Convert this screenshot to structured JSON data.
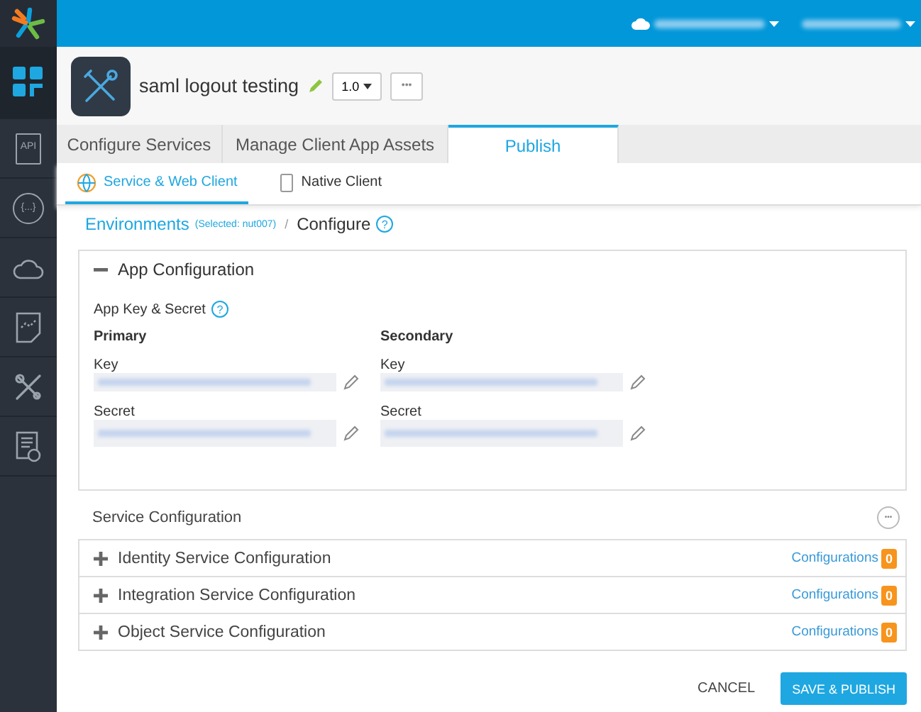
{
  "sidebar": {
    "items": [
      {
        "kind": "dashboard",
        "selected": true
      },
      {
        "kind": "api",
        "label": "API",
        "selected": false
      },
      {
        "kind": "chat",
        "label": "{...}",
        "selected": false
      },
      {
        "kind": "cloud",
        "selected": false
      },
      {
        "kind": "chart",
        "selected": false
      },
      {
        "kind": "tools",
        "selected": false
      },
      {
        "kind": "report",
        "selected": false
      }
    ]
  },
  "app": {
    "name": "saml logout testing",
    "version": "1.0",
    "more": "•••"
  },
  "tabs": [
    {
      "label": "Configure Services",
      "selected": false
    },
    {
      "label": "Manage Client App Assets",
      "selected": false
    },
    {
      "label": "Publish",
      "selected": true
    }
  ],
  "subtabs": [
    {
      "label": "Service & Web Client",
      "selected": true
    },
    {
      "label": "Native Client",
      "selected": false
    }
  ],
  "breadcrumb": {
    "link": "Environments",
    "selected": "(Selected: nut007)",
    "separator": "/",
    "current": "Configure",
    "help": "?"
  },
  "app_config": {
    "title": "App Configuration",
    "expanded": true,
    "heading": "App Key & Secret",
    "help": "?",
    "columns": [
      {
        "title": "Primary",
        "fields": [
          {
            "label": "Key"
          },
          {
            "label": "Secret"
          }
        ]
      },
      {
        "title": "Secondary",
        "fields": [
          {
            "label": "Key"
          },
          {
            "label": "Secret"
          }
        ]
      }
    ]
  },
  "service_config": {
    "title": "Service Configuration",
    "more": "•••",
    "rows": [
      {
        "title": "Identity Service Configuration",
        "expanded": false,
        "link": "Configurations",
        "count": "0"
      },
      {
        "title": "Integration Service Configuration",
        "expanded": false,
        "link": "Configurations",
        "count": "0"
      },
      {
        "title": "Object Service Configuration",
        "expanded": false,
        "link": "Configurations",
        "count": "0"
      }
    ]
  },
  "buttons": [
    {
      "label": "CANCEL",
      "kind": "text"
    },
    {
      "label": "SAVE & PUBLISH",
      "kind": "primary"
    }
  ]
}
